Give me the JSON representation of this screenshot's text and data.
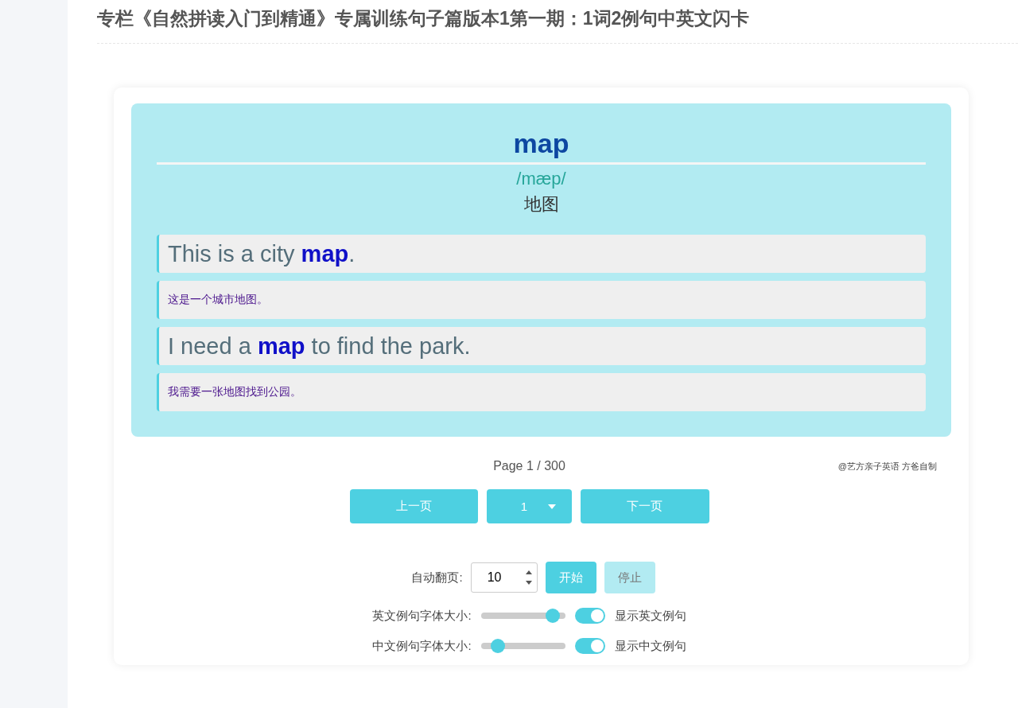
{
  "page_title": "专栏《自然拼读入门到精通》专属训练句子篇版本1第一期：1词2例句中英文闪卡",
  "card": {
    "word": "map",
    "phonetic": "/mæp/",
    "meaning": "地图",
    "sentences": [
      {
        "kind": "en",
        "text": "This is a city **map**."
      },
      {
        "kind": "zh",
        "text": "这是一个城市地图。"
      },
      {
        "kind": "en",
        "text": "I need a **map** to find the park."
      },
      {
        "kind": "zh",
        "text": "我需要一张地图找到公园。"
      }
    ]
  },
  "page_info": "Page 1 / 300",
  "credit": "@艺方亲子英语 方爸自制",
  "nav": {
    "prev": "上一页",
    "page_select": "1",
    "next": "下一页"
  },
  "auto_flip": {
    "label": "自动翻页:",
    "value": "10",
    "start": "开始",
    "stop": "停止",
    "start_disabled": false,
    "stop_disabled": true
  },
  "settings": [
    {
      "label": "英文例句字体大小:",
      "level": 0.85,
      "toggle_label": "显示英文例句",
      "on": true
    },
    {
      "label": "中文例句字体大小:",
      "level": 0.2,
      "toggle_label": "显示中文例句",
      "on": true
    }
  ]
}
